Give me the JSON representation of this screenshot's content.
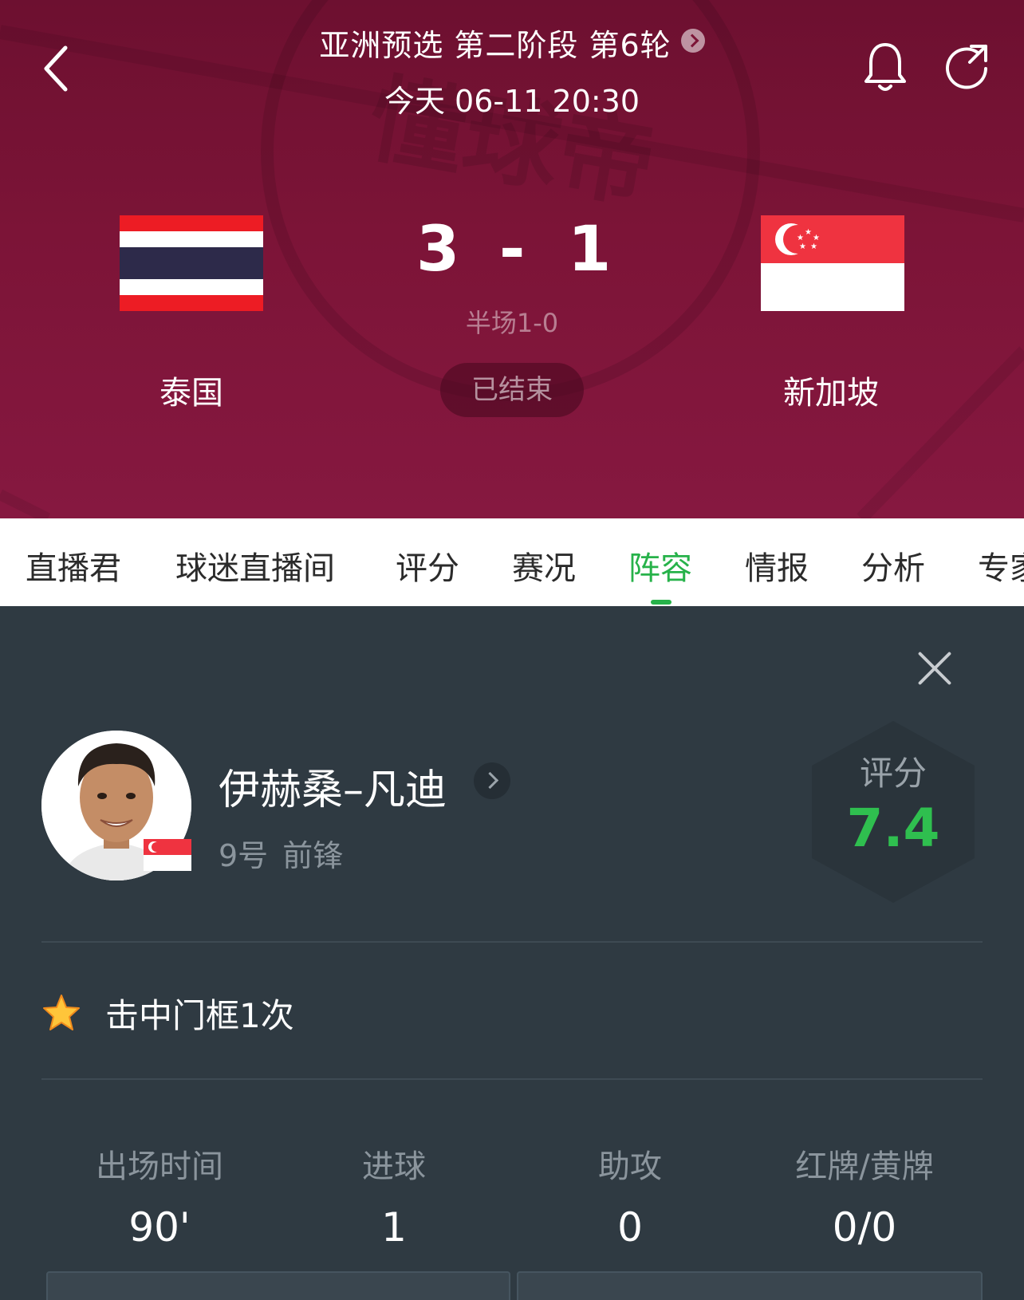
{
  "header": {
    "round_title": "亚洲预选 第二阶段 第6轮",
    "match_time": "今天 06-11 20:30",
    "watermark": "懂球帝",
    "icons": {
      "back": "chevron-left-icon",
      "bell": "bell-icon",
      "refresh": "refresh-icon"
    }
  },
  "match": {
    "home_team": "泰国",
    "away_team": "新加坡",
    "home_score": "3",
    "separator": "-",
    "away_score": "1",
    "halftime": "半场1-0",
    "status": "已结束"
  },
  "tabs": [
    {
      "label": "直播君"
    },
    {
      "label": "球迷直播间"
    },
    {
      "label": "评分"
    },
    {
      "label": "赛况"
    },
    {
      "label": "阵容",
      "active": true
    },
    {
      "label": "情报"
    },
    {
      "label": "分析"
    },
    {
      "label": "专家"
    }
  ],
  "player": {
    "name": "伊赫桑–凡迪",
    "number": "9号",
    "position": "前锋",
    "rating_label": "评分",
    "rating": "7.4",
    "highlight": "击中门框1次"
  },
  "stats": [
    {
      "label": "出场时间",
      "value": "90'"
    },
    {
      "label": "进球",
      "value": "1"
    },
    {
      "label": "助攻",
      "value": "0"
    },
    {
      "label": "红牌/黄牌",
      "value": "0/0"
    }
  ],
  "colors": {
    "header_bg": "#7c1437",
    "accent_green": "#27b24a",
    "rating_green": "#2fbf4f",
    "panel_bg": "#2f3a42"
  }
}
